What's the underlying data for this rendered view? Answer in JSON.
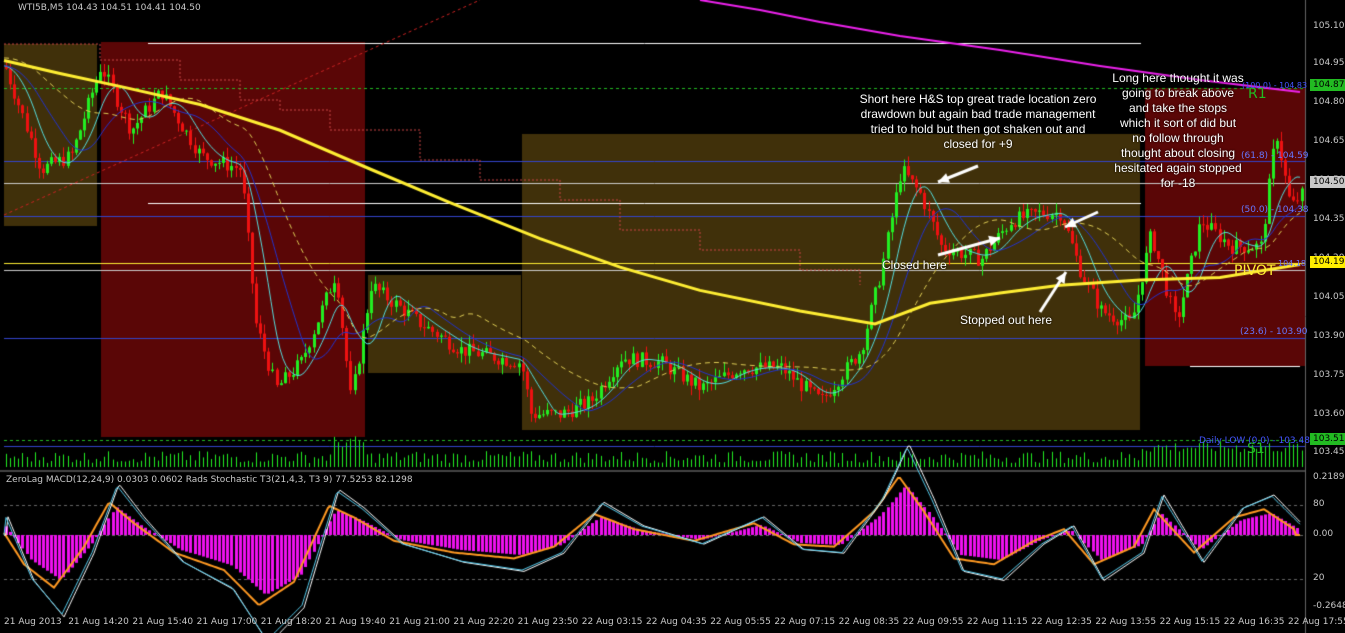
{
  "main_panel": {
    "header": "WTI5B,M5  104.43 104.51 104.41 104.50",
    "price_axis": [
      "105.10",
      "104.95",
      "104.80",
      "104.65",
      "104.50",
      "104.35",
      "104.20",
      "104.05",
      "103.90",
      "103.75",
      "103.60",
      "103.45"
    ],
    "price_tags": [
      {
        "text": "104.87",
        "bg": "#22bb22",
        "fg": "#000000"
      },
      {
        "text": "104.50",
        "bg": "#c8c8c8",
        "fg": "#000000"
      },
      {
        "text": "104.19",
        "bg": "#ffee00",
        "fg": "#000000"
      },
      {
        "text": "103.51",
        "bg": "#22bb22",
        "fg": "#000000"
      }
    ],
    "level_labels": {
      "r1": "R1",
      "pivot": "PIVOT",
      "s1": "S1",
      "fib_618": "(61.8) - 104.59",
      "fib_50": "(50.0) - 104.38",
      "fib_236": "(23.6) - 103.90",
      "fib_r1": "(100.0) - 104.83",
      "fib_mid": "104.18",
      "daily_low": "Daily LOW (0.0) - 103.48"
    }
  },
  "annotations": {
    "short_note": "Short here H&S top great trade location zero\ndrawdown but again bad trade management\ntried to hold but then got shaken out and\nclosed for +9",
    "long_note": "Long here thought it was\ngoing to break above\nand take the stops\nwhich it sort of did but\nno follow through\nthought about closing\nhesitated again stopped\nfor -18",
    "closed_here": "Closed here",
    "stopped_out": "Stopped out here"
  },
  "lower_panel": {
    "header": "ZeroLag MACD(12,24,9) 0.0303 0.0602  Rads Stochastic T3(21,4,3, T3 9) 77.5253 82.1298",
    "axis": [
      "0.2189",
      "80",
      "0.00",
      "20",
      "-0.2648"
    ]
  },
  "time_axis": [
    "21 Aug 2013",
    "21 Aug 14:20",
    "21 Aug 15:40",
    "21 Aug 17:00",
    "21 Aug 18:20",
    "21 Aug 19:40",
    "21 Aug 21:00",
    "21 Aug 22:20",
    "21 Aug 23:50",
    "22 Aug 03:15",
    "22 Aug 04:35",
    "22 Aug 05:55",
    "22 Aug 07:15",
    "22 Aug 08:35",
    "22 Aug 09:55",
    "22 Aug 11:15",
    "22 Aug 12:35",
    "22 Aug 13:55",
    "22 Aug 15:15",
    "22 Aug 16:35",
    "22 Aug 17:55"
  ],
  "colors": {
    "bull": "#22ee22",
    "bear": "#ee1111",
    "sma_slow": "#ffee33",
    "ema_magenta": "#ee22ee",
    "ma_cyan": "#55dddd",
    "ma_blue": "#2233cc",
    "box_olive": "#40300a",
    "box_maroon": "#5a0606",
    "hist": "#ee11ee",
    "macd_orange": "#ff9922"
  }
}
